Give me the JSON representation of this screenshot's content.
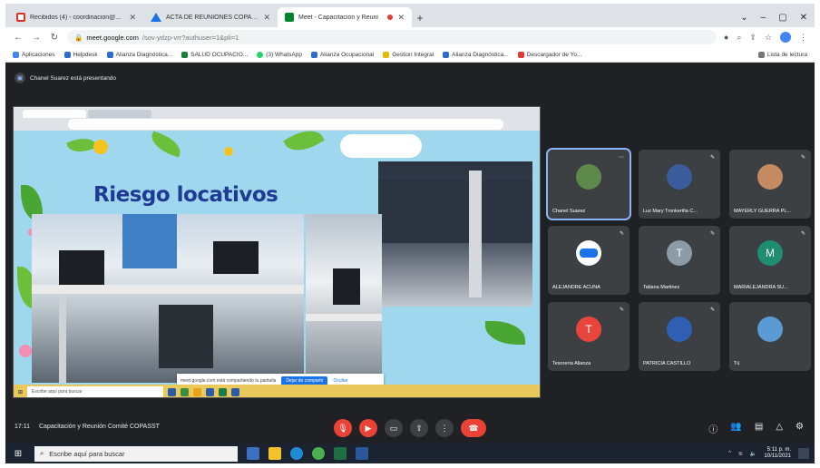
{
  "browser": {
    "tabs": [
      {
        "title": "Recibidos (4) - coordinacion@...",
        "icon": "gmail-icon"
      },
      {
        "title": "ACTA DE REUNIONES COPASST",
        "icon": "drive-icon"
      },
      {
        "title": "Meet - Capacitacion y Reuni",
        "icon": "meet-icon",
        "active": true
      }
    ],
    "url_host": "meet.google.com",
    "url_path": "/sov-ydzp-vrr?authuser=1&pli=1",
    "bookmarks": [
      "Aplicaciones",
      "Helpdesk",
      "Alianza Diagnóstica...",
      "SALUD OCUPACIO...",
      "(3) WhatsApp",
      "Alianza Ocupacional",
      "Gestion Integral",
      "Alianza Diagnóstica...",
      "Descargador de Yo...",
      "Lista de lectura"
    ]
  },
  "meet": {
    "presenting_text": "Chanel Suarez está presentando",
    "slide_title": "Riesgo locativos",
    "share_notice": "meet.google.com está compartiendo tu pantalla",
    "share_stop": "Dejar de compartir",
    "share_hide": "Ocultar",
    "inner_search": "Escribe aquí para buscar",
    "participants": [
      {
        "name": "Chanel Suarez",
        "kind": "photo",
        "speaking": true
      },
      {
        "name": "Luz Mary Tronkerifia C...",
        "kind": "photo"
      },
      {
        "name": "MAYERLY GUERRA PL...",
        "kind": "photo"
      },
      {
        "name": "ALEJANDRE ACUÑA",
        "kind": "logo"
      },
      {
        "name": "Tatiana Martinez",
        "kind": "letter",
        "letter": "T",
        "color": "#8d9ba6"
      },
      {
        "name": "MARIALEJANDRA SU...",
        "kind": "letter",
        "letter": "M",
        "color": "#1e8e6e"
      },
      {
        "name": "Tesorería Alianza",
        "kind": "letter",
        "letter": "T",
        "color": "#e8453c"
      },
      {
        "name": "PATRICIA CASTILLO",
        "kind": "photo2"
      },
      {
        "name": "Tú",
        "kind": "logo2"
      }
    ],
    "time": "17:11",
    "meeting_name": "Capacitación y Reunión Comité COPASST"
  },
  "taskbar": {
    "search_placeholder": "Escribe aquí para buscar",
    "time": "5:11 p. m.",
    "date": "10/11/2021"
  }
}
